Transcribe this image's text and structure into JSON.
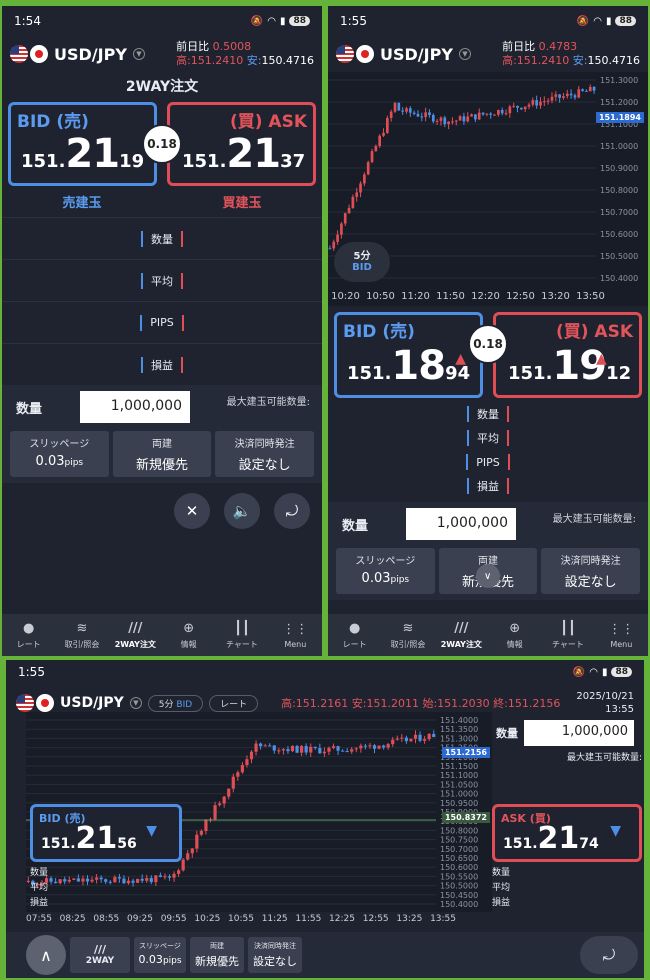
{
  "panel1": {
    "status": {
      "time": "1:54",
      "battery": "88"
    },
    "pair": "USD/JPY",
    "prev_day_label": "前日比",
    "prev_day_value": "0.5008",
    "high": "高:151.2410",
    "low_label": "安:",
    "low": "150.4716",
    "title": "2WAY注文",
    "bid": {
      "label": "BID (売)",
      "p1": "151.",
      "p2": "21",
      "p3": "19"
    },
    "ask": {
      "label": "(買) ASK",
      "p1": "151.",
      "p2": "21",
      "p3": "37"
    },
    "spread": "0.18",
    "sell_label": "売建玉",
    "buy_label": "買建玉",
    "rows": [
      "数量",
      "平均",
      "PIPS",
      "損益"
    ],
    "qty_label": "数量",
    "qty_value": "1,000,000",
    "max_note": "最大建玉可能数量:",
    "opts": [
      {
        "title": "スリッページ",
        "value": "0.03",
        "unit": "pips"
      },
      {
        "title": "両建",
        "value": "新規優先"
      },
      {
        "title": "決済同時発注",
        "value": "設定なし"
      }
    ],
    "nav": [
      "レート",
      "取引/照会",
      "2WAY注文",
      "情報",
      "チャート",
      "Menu"
    ]
  },
  "panel2": {
    "status": {
      "time": "1:55",
      "battery": "88"
    },
    "pair": "USD/JPY",
    "prev_day_label": "前日比",
    "prev_day_value": "0.4783",
    "high": "高:151.2410",
    "low_label": "安:",
    "low": "150.4716",
    "price_tag": "151.1894",
    "y_ticks": [
      "151.3000",
      "151.2000",
      "151.1000",
      "151.0000",
      "150.9000",
      "150.8000",
      "150.7000",
      "150.6000",
      "150.5000",
      "150.4000"
    ],
    "x_ticks": [
      "10:20",
      "10:50",
      "11:20",
      "11:50",
      "12:20",
      "12:50",
      "13:20",
      "13:50"
    ],
    "tf": "5分",
    "tf_side": "BID",
    "bid": {
      "label": "BID (売)",
      "p1": "151.",
      "p2": "18",
      "p3": "94"
    },
    "ask": {
      "label": "(買) ASK",
      "p1": "151.",
      "p2": "19",
      "p3": "12"
    },
    "spread": "0.18",
    "rows": [
      "数量",
      "平均",
      "PIPS",
      "損益"
    ],
    "qty_label": "数量",
    "qty_value": "1,000,000",
    "max_note": "最大建玉可能数量:",
    "opts": [
      {
        "title": "スリッページ",
        "value": "0.03",
        "unit": "pips"
      },
      {
        "title": "両建",
        "value": "新規優先"
      },
      {
        "title": "決済同時発注",
        "value": "設定なし"
      }
    ],
    "nav": [
      "レート",
      "取引/照会",
      "2WAY注文",
      "情報",
      "チャート",
      "Menu"
    ]
  },
  "panel3": {
    "status": {
      "time": "1:55",
      "battery": "88"
    },
    "pair": "USD/JPY",
    "tf_pill": "5分",
    "tf_side": "BID",
    "rate_pill": "レート",
    "stats": "高:151.2161 安:151.2011 始:151.2030 終:151.2156",
    "date": "2025/10/21",
    "time": "13:55",
    "y_ticks": [
      "151.4000",
      "151.3500",
      "151.3000",
      "151.2500",
      "151.2000",
      "151.1500",
      "151.1000",
      "151.0500",
      "151.0000",
      "150.9500",
      "150.9000",
      "150.8500",
      "150.8000",
      "150.7500",
      "150.7000",
      "150.6500",
      "150.6000",
      "150.5500",
      "150.5000",
      "150.4500",
      "150.4000"
    ],
    "x_ticks": [
      "07:55",
      "08:25",
      "08:55",
      "09:25",
      "09:55",
      "10:25",
      "10:55",
      "11:25",
      "11:55",
      "12:25",
      "12:55",
      "13:25",
      "13:55"
    ],
    "price_tag": "151.2156",
    "line_tag": "150.8372",
    "bid": {
      "label": "BID (売)",
      "p1": "151.",
      "p2": "21",
      "p3": "56"
    },
    "ask": {
      "label": "ASK (買)",
      "p1": "151.",
      "p2": "21",
      "p3": "74"
    },
    "rows": [
      "数量",
      "平均",
      "損益"
    ],
    "qty_label": "数量",
    "qty_value": "1,000,000",
    "max_note": "最大建玉可能数量:",
    "twoway": "2WAY",
    "opts": [
      {
        "title": "スリッページ",
        "value": "0.03",
        "unit": "pips"
      },
      {
        "title": "両建",
        "value": "新規優先"
      },
      {
        "title": "決済同時発注",
        "value": "設定なし"
      }
    ]
  },
  "colors": {
    "bid": "#4d8fe5",
    "ask": "#e04e55",
    "bg": "#1f2330",
    "frame": "#66b33a"
  }
}
